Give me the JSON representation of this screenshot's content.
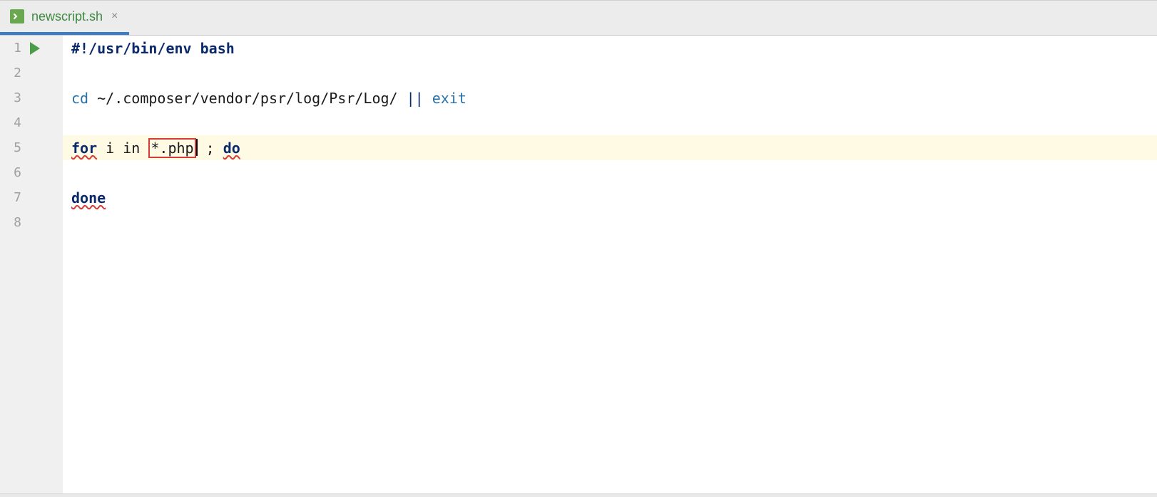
{
  "tab": {
    "filename": "newscript.sh",
    "close_symbol": "×"
  },
  "gutter": {
    "lines": [
      "1",
      "2",
      "3",
      "4",
      "5",
      "6",
      "7",
      "8"
    ]
  },
  "code": {
    "line1": {
      "shebang": "#!/usr/bin/env bash"
    },
    "line3": {
      "cd": "cd",
      "path": " ~/.composer/vendor/psr/log/Psr/Log/ ",
      "or": "||",
      "space": " ",
      "exit": "exit"
    },
    "line5": {
      "for": "for",
      "i_in": " i in ",
      "glob": "*.php",
      "sep": " ; ",
      "do": "do"
    },
    "line7": {
      "done": "done"
    }
  }
}
